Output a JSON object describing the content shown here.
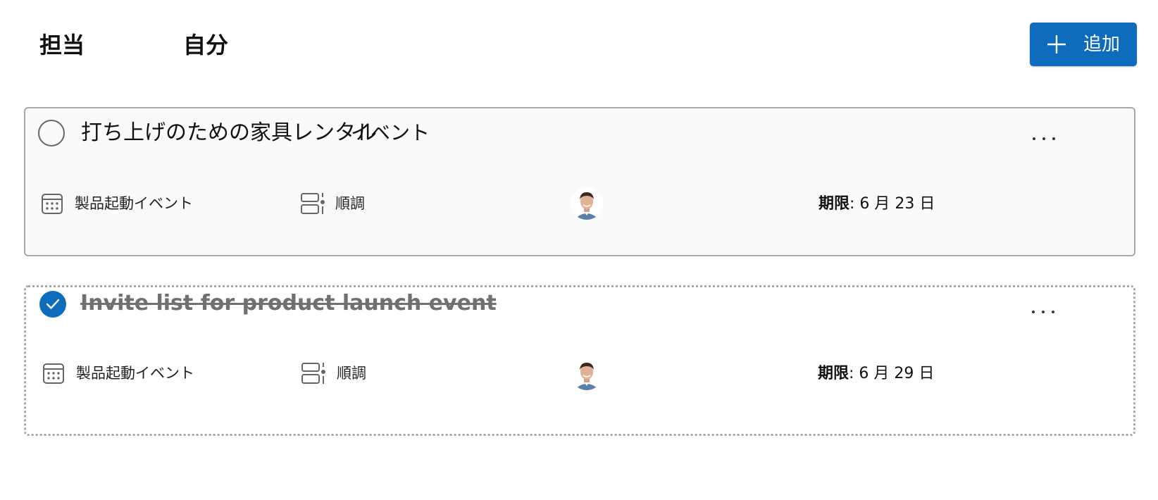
{
  "header": {
    "assigned_label": "担当",
    "me_label": "自分",
    "add_button": {
      "label": "追加",
      "icon": "plus-icon"
    }
  },
  "colors": {
    "accent": "#0f6cbd",
    "card_border": "#a8a8a8",
    "done_text": "#707070"
  },
  "tasks": [
    {
      "title": "打ち上げのための家具レンタル",
      "tag": "イベント",
      "completed": false,
      "plan": {
        "icon": "calendar-icon",
        "label": "製品起動イベント"
      },
      "status": {
        "icon": "status-layout-icon",
        "label": "順調"
      },
      "assignee": {
        "icon": "avatar"
      },
      "due": {
        "label": "期限",
        "value": ": 6 月 23 日"
      },
      "more": "more-icon"
    },
    {
      "title": "Invite list for product launch event",
      "completed": true,
      "plan": {
        "icon": "calendar-icon",
        "label": "製品起動イベント"
      },
      "status": {
        "icon": "status-layout-icon",
        "label": "順調"
      },
      "assignee": {
        "icon": "avatar"
      },
      "due": {
        "label": "期限",
        "value": ": 6 月 29 日"
      },
      "more": "more-icon"
    }
  ]
}
